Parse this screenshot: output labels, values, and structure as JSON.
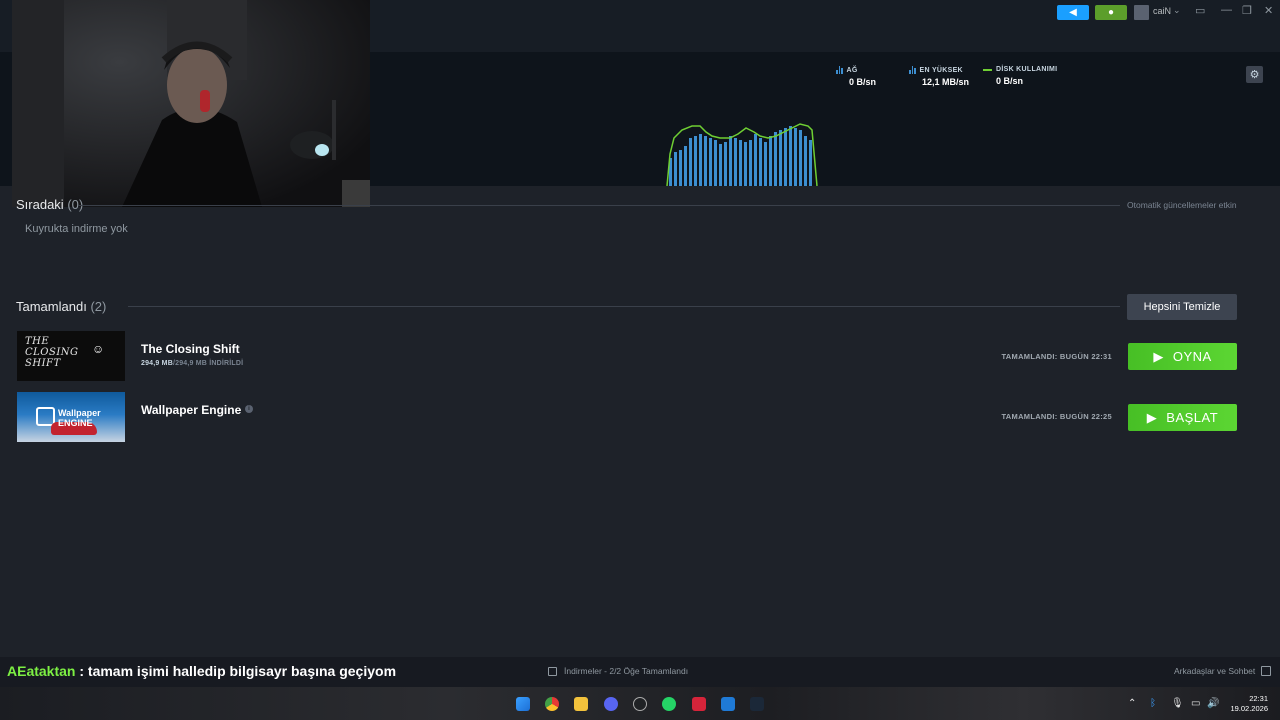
{
  "titlebar": {
    "username": "caiN"
  },
  "stats": [
    {
      "label": "AĞ",
      "value": "0 B/sn"
    },
    {
      "label": "EN YÜKSEK",
      "value": "12,1 MB/sn"
    },
    {
      "label": "DİSK KULLANIMI",
      "value": "0 B/sn"
    }
  ],
  "queue": {
    "title": "Sıradaki",
    "count": "(0)",
    "auto_updates": "Otomatik güncellemeler etkin",
    "empty_text": "Kuyrukta indirme yok"
  },
  "completed": {
    "title": "Tamamlandı",
    "count": "(2)",
    "clear_label": "Hepsini Temizle",
    "items": [
      {
        "title": "The Closing Shift",
        "thumb_text": "THE CLOSING SHIFT",
        "size_done": "294,9 MB",
        "size_total": "/294,9 MB İNDİRİLDİ",
        "status": "TAMAMLANDI: BUGÜN 22:31",
        "action": "OYNA"
      },
      {
        "title": "Wallpaper Engine",
        "thumb_text": "Wallpaper ENGINE",
        "status": "TAMAMLANDI: BUGÜN 22:25",
        "action": "BAŞLAT"
      }
    ]
  },
  "chat": {
    "name": "AEataktan",
    "message": " : tamam işimi halledip bilgisayr başına geçiyom"
  },
  "bottombar": {
    "downloads_status": "İndirmeler - 2/2 Öğe Tamamlandı",
    "friends_label": "Arkadaşlar ve Sohbet"
  },
  "taskbar": {
    "time": "22:31",
    "date": "19.02.2026"
  },
  "colors": {
    "accent_green": "#5cd633",
    "steam_blue": "#1a9fff",
    "graph_line": "#6fcf33",
    "graph_bar": "#3d8fd1"
  }
}
